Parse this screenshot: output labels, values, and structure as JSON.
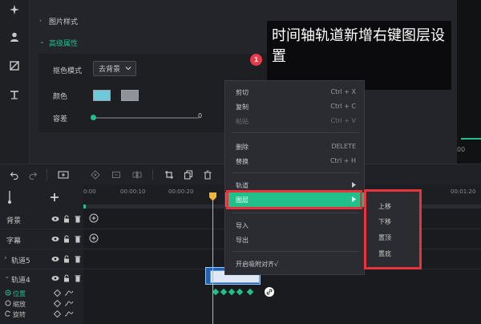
{
  "properties": {
    "section_image_style": "图片样式",
    "section_advanced": "高级属性",
    "blend_mode_label": "抠色模式",
    "blend_mode_value": "去背景",
    "color_label": "颜色",
    "tolerance_label": "容差",
    "tolerance_value": "0",
    "swatch_primary": "#6ec9d9",
    "swatch_secondary": "#8f9399"
  },
  "callout": {
    "badge": "1",
    "text": "时间轴轨道新增右键图层设置"
  },
  "ruler": {
    "ticks": [
      "0:00",
      "00:00:10",
      "00:00:20",
      "00:01:20"
    ]
  },
  "tracks": [
    {
      "name": "背景"
    },
    {
      "name": "字幕"
    },
    {
      "name": "轨道5"
    },
    {
      "name": "轨道4"
    }
  ],
  "subtracks": [
    "位置",
    "缩放",
    "旋转"
  ],
  "context_menu": {
    "items": [
      {
        "label": "剪切",
        "shortcut": "Ctrl + X"
      },
      {
        "label": "复制",
        "shortcut": "Ctrl + C"
      },
      {
        "label": "粘贴",
        "shortcut": "Ctrl + V"
      },
      {
        "label": "删除",
        "shortcut": "DELETE"
      },
      {
        "label": "替换",
        "shortcut": "Ctrl + H"
      },
      {
        "label": "轨道",
        "shortcut": ""
      },
      {
        "label": "图层",
        "shortcut": ""
      },
      {
        "label": "导入",
        "shortcut": ""
      },
      {
        "label": "导出",
        "shortcut": ""
      },
      {
        "label": "开启吸附对齐√",
        "shortcut": ""
      }
    ]
  },
  "submenu": {
    "items": [
      "上移",
      "下移",
      "置顶",
      "置底"
    ]
  },
  "colors": {
    "accent": "#21c08a",
    "highlight_border": "#e8323c",
    "playhead": "#f2b53a",
    "clip": "#1d63b9"
  }
}
